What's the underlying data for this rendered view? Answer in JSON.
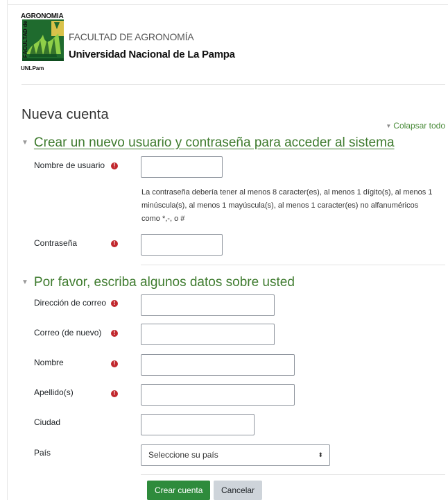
{
  "header": {
    "logo_top": "AGRONOMIA",
    "logo_side": "FACULTAD de",
    "logo_bottom": "UNLPam",
    "faculty": "FACULTAD DE AGRONOMÍA",
    "university": "Universidad Nacional de La Pampa"
  },
  "page_title": "Nueva cuenta",
  "collapse_all": "Colapsar todo",
  "section1": {
    "title": "Crear un nuevo usuario y contraseña para acceder al sistema",
    "username_label": "Nombre de usuario",
    "password_hint": "La contraseña debería tener al menos 8 caracter(es), al menos 1 dígito(s), al menos 1 minúscula(s), al menos 1 mayúscula(s), al menos 1 caracter(es) no alfanuméricos como *,-, o #",
    "password_label": "Contraseña"
  },
  "section2": {
    "title": "Por favor, escriba algunos datos sobre usted",
    "email_label": "Dirección de correo",
    "email2_label": "Correo (de nuevo)",
    "firstname_label": "Nombre",
    "lastname_label": "Apellido(s)",
    "city_label": "Ciudad",
    "country_label": "País",
    "country_value": "Seleccione su país"
  },
  "buttons": {
    "submit": "Crear cuenta",
    "cancel": "Cancelar"
  },
  "colors": {
    "accent_green": "#3e7b2e",
    "button_green": "#2e8b3c",
    "required_red": "#c1272d"
  },
  "icons": {
    "required": "exclamation-circle-icon",
    "collapse": "triangle-down-icon",
    "select_arrow": "sort-arrows-icon"
  }
}
